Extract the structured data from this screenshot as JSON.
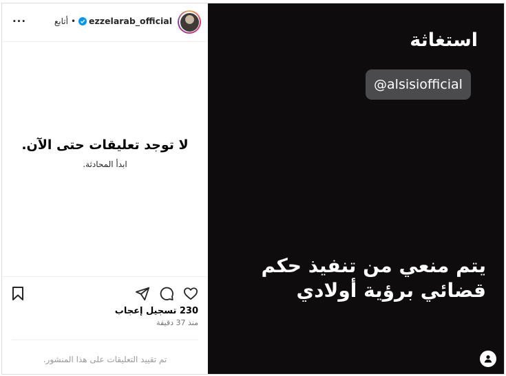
{
  "header": {
    "username": "ezzelarab_official",
    "follow_label": "أتابع",
    "separator": "•",
    "more_label": "···"
  },
  "comments": {
    "empty_title": "لا توجد تعليقات حتى الآن.",
    "empty_subtitle": "ابدأ المحادثة."
  },
  "post": {
    "likes": "230 تسجيل إعجاب",
    "time": "منذ 37 دقيقة",
    "restricted_note": "تم تقييد التعليقات على هذا المنشور."
  },
  "media": {
    "title": "استغاثة",
    "mention": "@alsisiofficial",
    "body_line1": "يتم منعي من تنفيذ حكم",
    "body_line2": "قضائي برؤية أولادي"
  },
  "icons": [
    "more-icon",
    "verified-icon",
    "heart-icon",
    "comment-icon",
    "share-icon",
    "bookmark-icon",
    "user-tag-icon"
  ],
  "colors": {
    "media_bg": "#0e0c0d",
    "mention_bg": "#4b4b4d",
    "verified": "#0095f6",
    "muted_text": "#737373"
  }
}
